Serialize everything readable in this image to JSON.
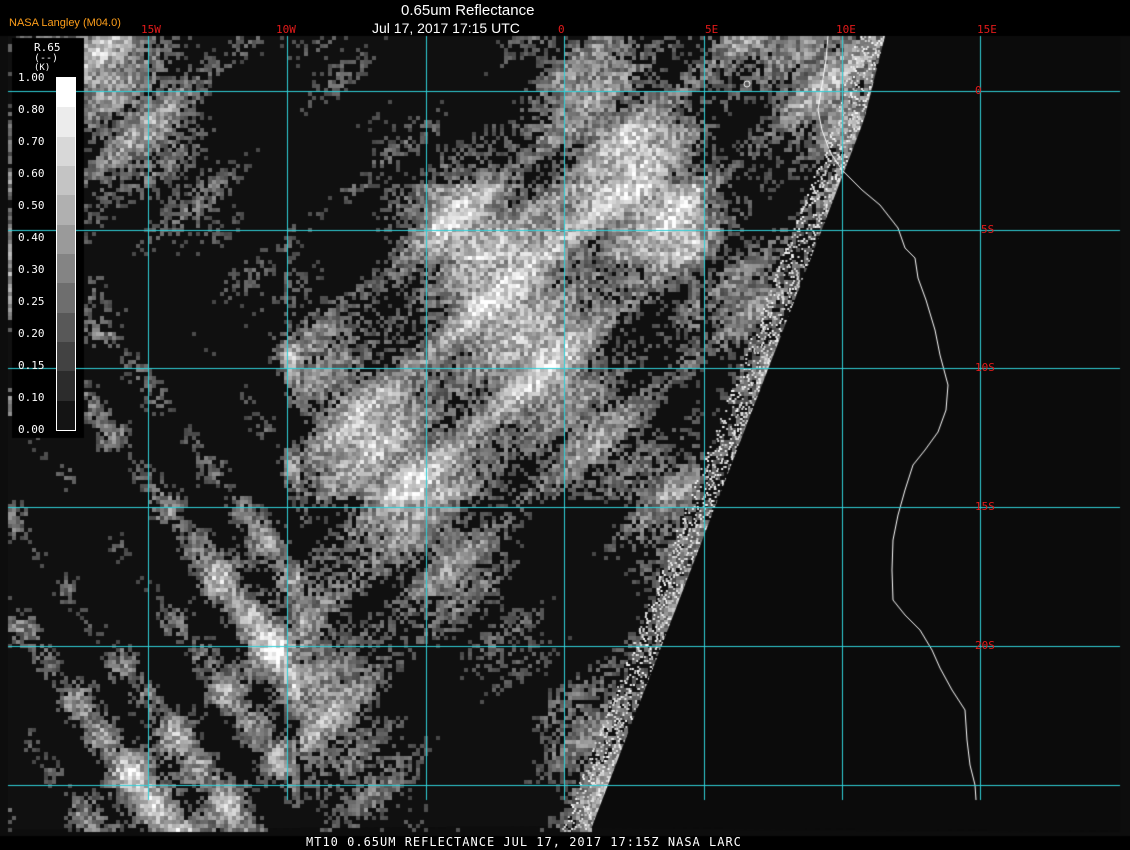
{
  "header": {
    "credit": "NASA Langley (M04.0)",
    "title": "0.65um Reflectance",
    "datetime": "Jul 17, 2017 17:15 UTC"
  },
  "longitude_labels": [
    "15W",
    "10W",
    "0",
    "5E",
    "10E",
    "15E"
  ],
  "latitude_labels": [
    "0",
    "5S",
    "10S",
    "15S",
    "20S"
  ],
  "legend": {
    "title": "R.65",
    "unit": "(--)",
    "corner": "(K)",
    "ticks": [
      "1.00",
      "0.80",
      "0.70",
      "0.60",
      "0.50",
      "0.40",
      "0.30",
      "0.25",
      "0.20",
      "0.15",
      "0.10",
      "0.00"
    ],
    "colors": [
      "#ffffff",
      "#ececec",
      "#d8d8d8",
      "#c4c4c4",
      "#b0b0b0",
      "#9a9a9a",
      "#848484",
      "#6e6e6e",
      "#585858",
      "#424242",
      "#2c2c2c",
      "#141414"
    ]
  },
  "footer": "MT10  0.65UM REFLECTANCE   JUL 17, 2017 17:15Z   NASA LARC",
  "colors": {
    "grid": "#2fd0d8",
    "label": "#e31a1a",
    "credit": "#ff9f1a",
    "coast": "#ffffff",
    "ocean": "#0b0b0b"
  }
}
